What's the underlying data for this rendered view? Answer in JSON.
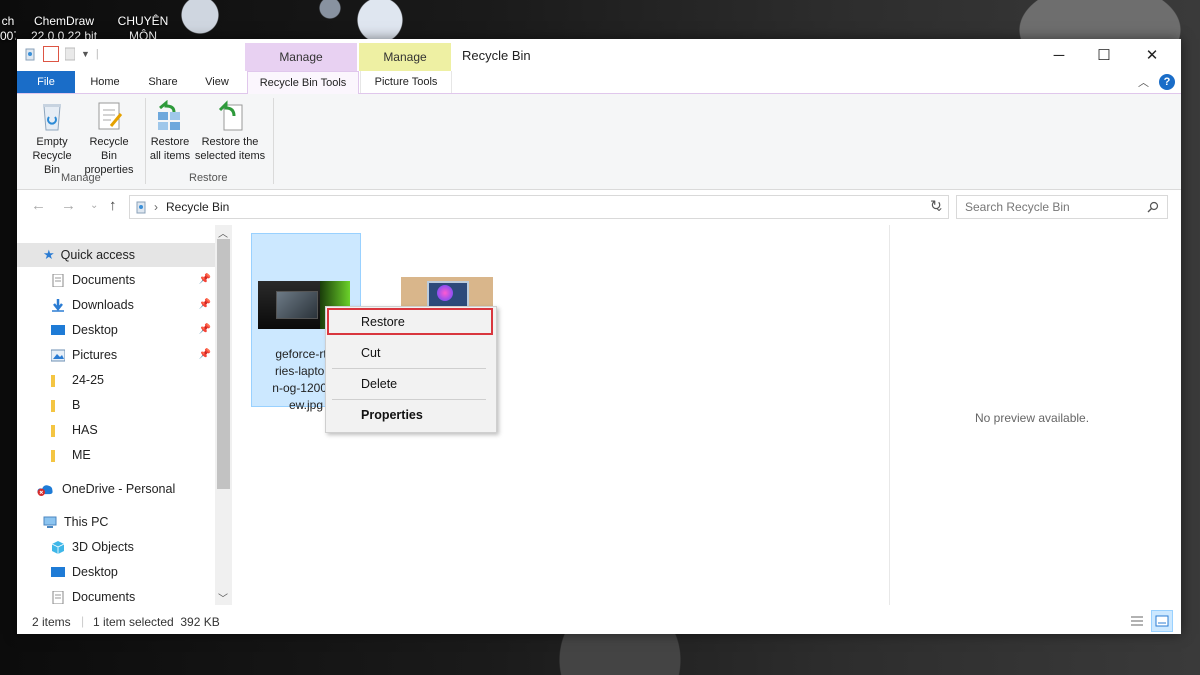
{
  "desktop": {
    "icons": [
      {
        "label_line1": "ch",
        "label_line2": "007"
      },
      {
        "label_line1": "ChemDraw",
        "label_line2": "22.0.0.22 bit"
      },
      {
        "label_line1": "CHUYÊN",
        "label_line2": "MÔN"
      }
    ]
  },
  "window": {
    "title": "Recycle Bin",
    "contextual_tabs": {
      "recycle": "Manage",
      "picture": "Manage"
    },
    "tabs": {
      "file": "File",
      "home": "Home",
      "share": "Share",
      "view": "View",
      "recycle_tools": "Recycle Bin Tools",
      "picture_tools": "Picture Tools"
    },
    "controls": {
      "minimize": "─",
      "maximize": "☐",
      "close": "✕"
    },
    "help": "?"
  },
  "ribbon": {
    "empty_line1": "Empty",
    "empty_line2": "Recycle Bin",
    "props_line1": "Recycle Bin",
    "props_line2": "properties",
    "restore_all_line1": "Restore",
    "restore_all_line2": "all items",
    "restore_sel_line1": "Restore the",
    "restore_sel_line2": "selected items",
    "group_manage": "Manage",
    "group_restore": "Restore"
  },
  "address": {
    "path": "Recycle Bin",
    "search_placeholder": "Search Recycle Bin"
  },
  "nav": {
    "quick_access": "Quick access",
    "items": [
      {
        "label": "Documents",
        "pinned": true
      },
      {
        "label": "Downloads",
        "pinned": true
      },
      {
        "label": "Desktop",
        "pinned": true
      },
      {
        "label": "Pictures",
        "pinned": true
      },
      {
        "label": "24-25"
      },
      {
        "label": "B"
      },
      {
        "label": "HAS"
      },
      {
        "label": "ME"
      }
    ],
    "onedrive": "OneDrive - Personal",
    "thispc": "This PC",
    "pc_items": [
      {
        "label": "3D Objects"
      },
      {
        "label": "Desktop"
      },
      {
        "label": "Documents"
      }
    ]
  },
  "files": {
    "file1": {
      "line1": "geforce-rtx-",
      "line2": "ries-laptops",
      "line3": "n-og-1200x6",
      "line4": "ew.jpg"
    }
  },
  "context_menu": {
    "restore": "Restore",
    "cut": "Cut",
    "delete": "Delete",
    "properties": "Properties"
  },
  "preview": {
    "text": "No preview available."
  },
  "status": {
    "count": "2 items",
    "selection": "1 item selected  392 KB"
  },
  "colors": {
    "accent": "#1a6dc8",
    "selection": "#cce8ff",
    "highlight": "#d9363e"
  }
}
